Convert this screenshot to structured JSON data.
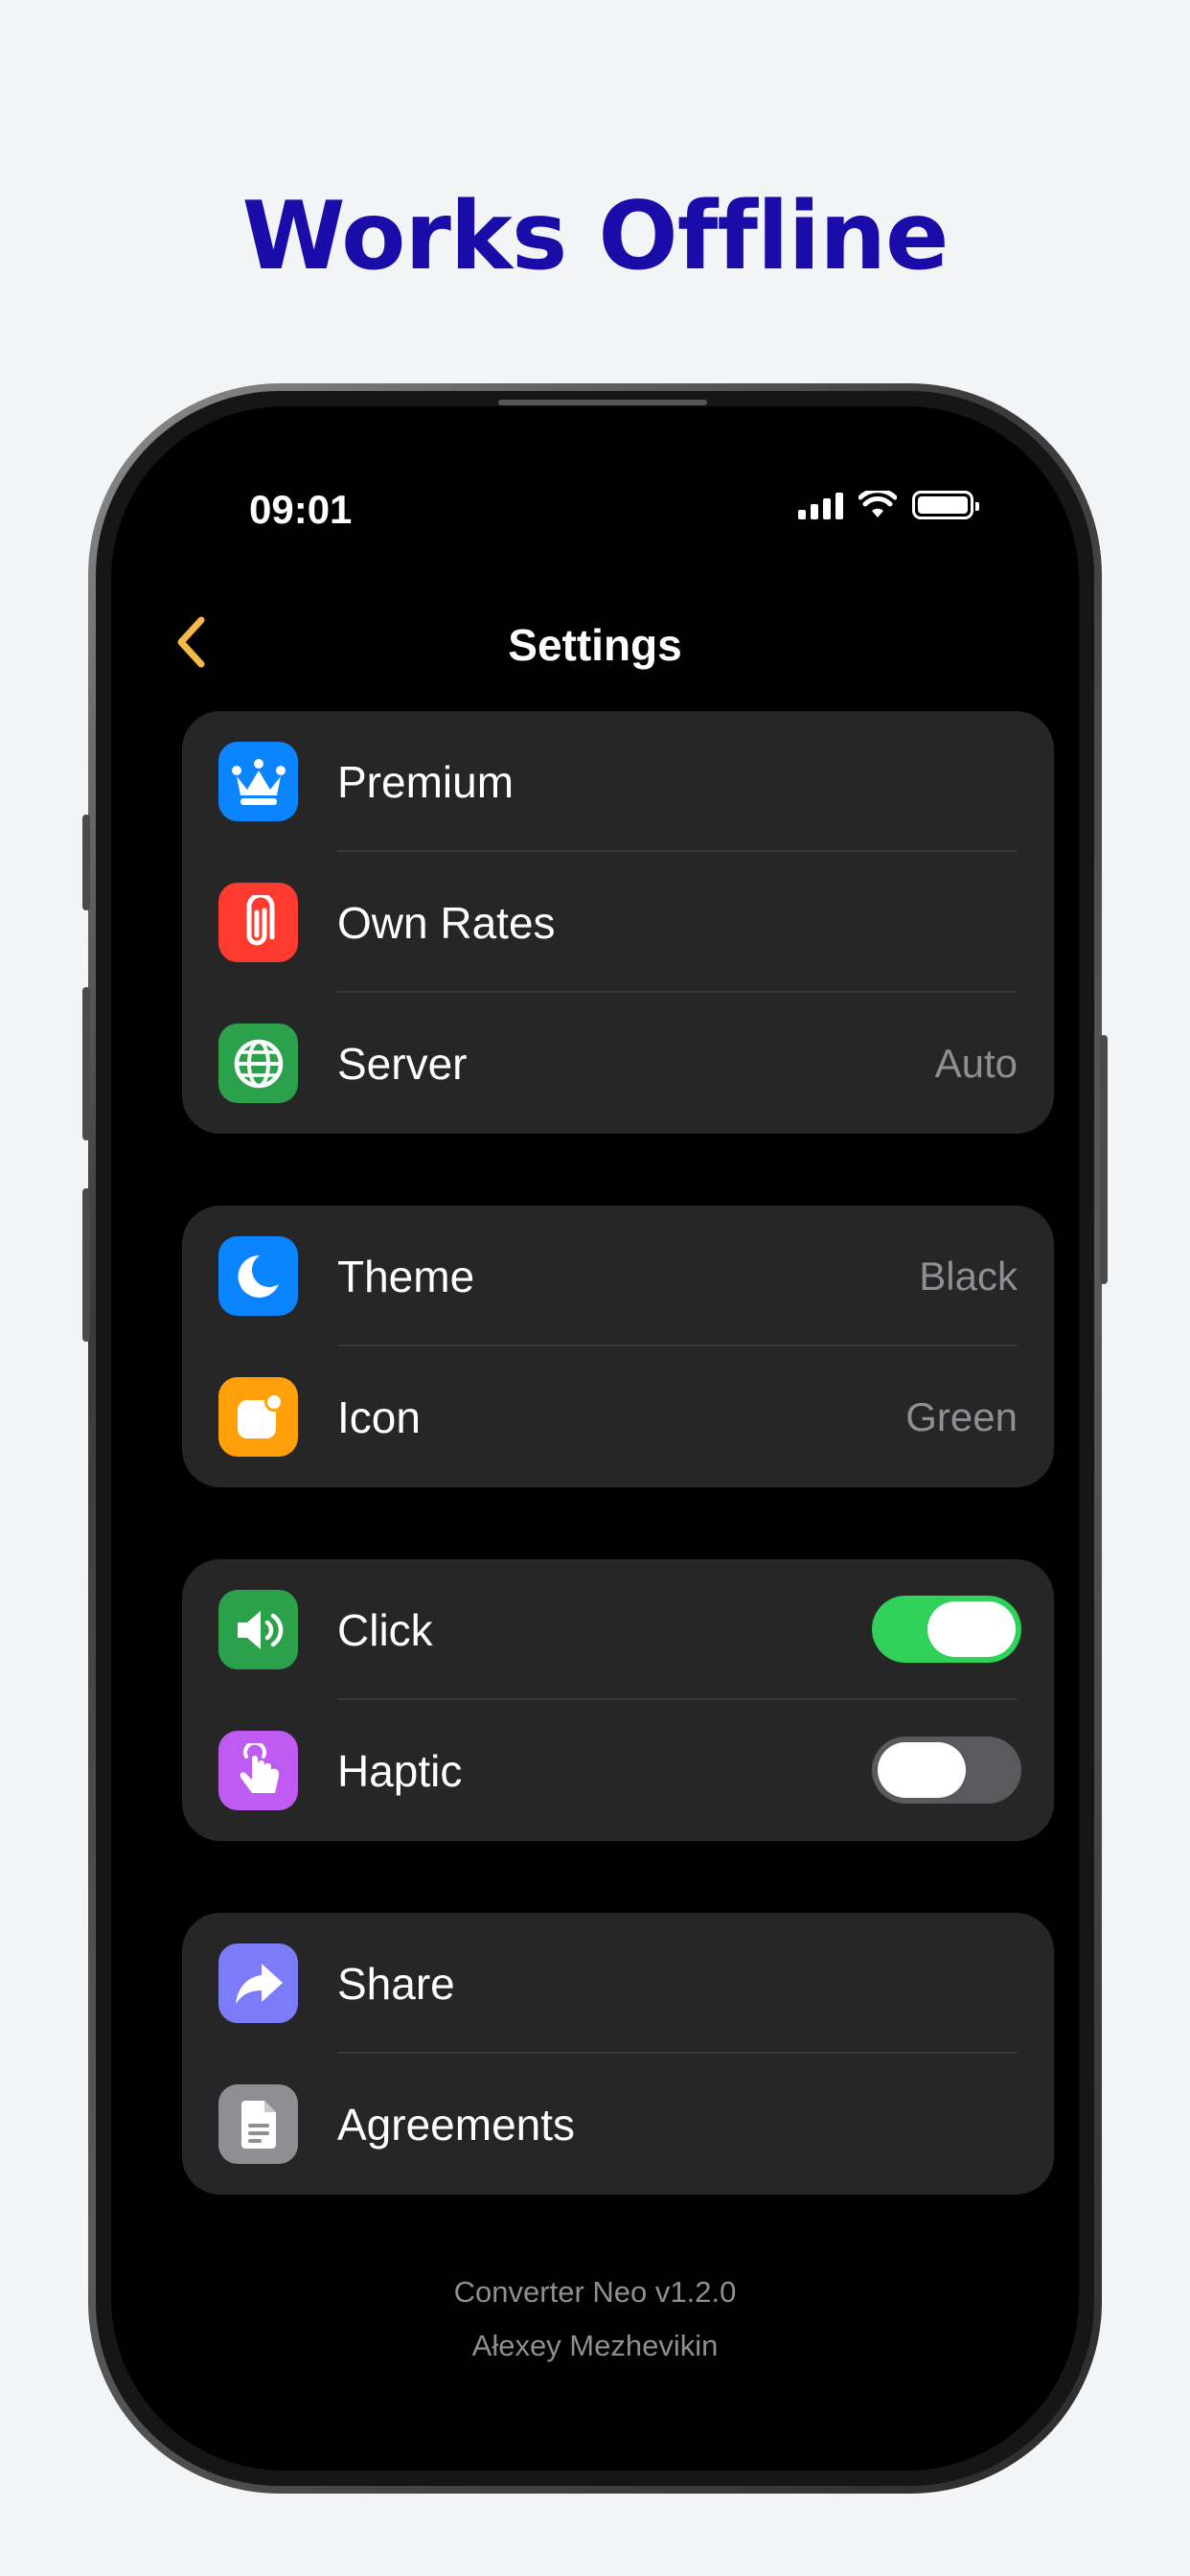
{
  "headline": "Works Offline",
  "status_bar": {
    "time": "09:01"
  },
  "nav": {
    "title": "Settings"
  },
  "groups": [
    {
      "rows": [
        {
          "label": "Premium",
          "value": "",
          "icon": "crown-icon",
          "color": "#0a84ff"
        },
        {
          "label": "Own Rates",
          "value": "",
          "icon": "paperclip-icon",
          "color": "#ff3b30"
        },
        {
          "label": "Server",
          "value": "Auto",
          "icon": "globe-icon",
          "color": "#2aa14a"
        }
      ]
    },
    {
      "rows": [
        {
          "label": "Theme",
          "value": "Black",
          "icon": "moon-icon",
          "color": "#0a84ff"
        },
        {
          "label": "Icon",
          "value": "Green",
          "icon": "app-badge-icon",
          "color": "#ff9f0a"
        }
      ]
    },
    {
      "rows": [
        {
          "label": "Click",
          "toggle": true,
          "icon": "speaker-icon",
          "color": "#2aa14a"
        },
        {
          "label": "Haptic",
          "toggle": false,
          "icon": "hand-tap-icon",
          "color": "#bf5af2"
        }
      ]
    },
    {
      "rows": [
        {
          "label": "Share",
          "value": "",
          "icon": "share-arrow-icon",
          "color": "#7d7cf8"
        },
        {
          "label": "Agreements",
          "value": "",
          "icon": "document-icon",
          "color": "#8e8e93"
        }
      ]
    }
  ],
  "footer": {
    "version": "Converter Neo v1.2.0",
    "author": "Ałexey Mezhevikin"
  },
  "colors": {
    "accent": "#f5b94a",
    "headline": "#1a0ca8",
    "toggle_on": "#30d158"
  }
}
